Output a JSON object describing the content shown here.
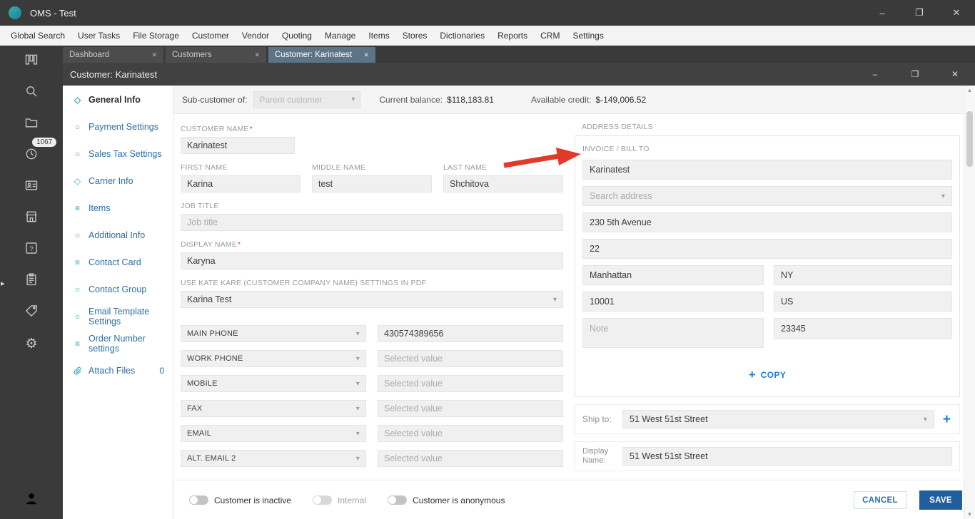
{
  "window": {
    "title": "OMS - Test"
  },
  "icons": {
    "chevron_down": "▾",
    "close": "✕",
    "minimize": "–",
    "restore": "❐",
    "plus": "+",
    "gear": "⚙",
    "question": "?",
    "diamond": "◇",
    "circle": "○",
    "lines": "≡",
    "arrow_up": "▲",
    "arrow_down": "▼",
    "expander": "▸"
  },
  "menu": {
    "items": [
      "Global Search",
      "User Tasks",
      "File Storage",
      "Customer",
      "Vendor",
      "Quoting",
      "Manage",
      "Items",
      "Stores",
      "Dictionaries",
      "Reports",
      "CRM",
      "Settings"
    ]
  },
  "tabs": [
    {
      "label": "Dashboard"
    },
    {
      "label": "Customers"
    },
    {
      "label": "Customer: Karinatest"
    }
  ],
  "sidebar": {
    "badge": "1067"
  },
  "inner_window": {
    "title": "Customer: Karinatest"
  },
  "subheader": {
    "sub_customer_label": "Sub-customer of:",
    "sub_customer_placeholder": "Parent customer",
    "current_balance_label": "Current balance:",
    "current_balance_value": "$118,183.81",
    "available_credit_label": "Available credit:",
    "available_credit_value": "$-149,006.52"
  },
  "nav": {
    "items": [
      {
        "label": "General Info",
        "icon": "diamond",
        "active": true
      },
      {
        "label": "Payment Settings",
        "icon": "circle"
      },
      {
        "label": "Sales Tax Settings",
        "icon": "circle"
      },
      {
        "label": "Carrier Info",
        "icon": "diamond"
      },
      {
        "label": "Items",
        "icon": "lines"
      },
      {
        "label": "Additional Info",
        "icon": "circle"
      },
      {
        "label": "Contact Card",
        "icon": "lines"
      },
      {
        "label": "Contact Group",
        "icon": "circle"
      },
      {
        "label": "Email Template Settings",
        "icon": "circle"
      },
      {
        "label": "Order Number settings",
        "icon": "lines"
      },
      {
        "label": "Attach Files",
        "icon": "paperclip",
        "badge": "0"
      }
    ]
  },
  "form": {
    "required_mark": "*",
    "customer_name": {
      "label": "CUSTOMER NAME",
      "value": "Karinatest"
    },
    "first_name": {
      "label": "FIRST NAME",
      "value": "Karina"
    },
    "middle_name": {
      "label": "MIDDLE NAME",
      "value": "test"
    },
    "last_name": {
      "label": "LAST NAME",
      "value": "Shchitova"
    },
    "job_title": {
      "label": "JOB TITLE",
      "placeholder": "Job title"
    },
    "display_name": {
      "label": "DISPLAY NAME",
      "value": "Karyna"
    },
    "pdf_settings": {
      "label": "USE KATE KARE (CUSTOMER COMPANY NAME) SETTINGS IN PDF",
      "value": "Karina Test"
    },
    "phones": [
      {
        "type": "MAIN PHONE",
        "value": "430574389656"
      },
      {
        "type": "WORK PHONE",
        "placeholder": "Selected value"
      },
      {
        "type": "MOBILE",
        "placeholder": "Selected value"
      },
      {
        "type": "FAX",
        "placeholder": "Selected value"
      },
      {
        "type": "EMAIL",
        "placeholder": "Selected value"
      },
      {
        "type": "ALT. EMAIL 2",
        "placeholder": "Selected value"
      }
    ],
    "toggles": [
      {
        "label": "Customer is inactive",
        "on": false
      },
      {
        "label": "Internal",
        "on": false,
        "muted": true
      },
      {
        "label": "Customer is anonymous",
        "on": false
      }
    ]
  },
  "address": {
    "title": "ADDRESS DETAILS",
    "section": "INVOICE / BILL TO",
    "name": "Karinatest",
    "search_placeholder": "Search address",
    "street": "230 5th Avenue",
    "apt": "22",
    "city": "Manhattan",
    "state": "NY",
    "zip": "10001",
    "country": "US",
    "note_placeholder": "Note",
    "extra": "23345",
    "copy_label": "COPY",
    "ship_to_label": "Ship to:",
    "ship_to_value": "51 West 51st Street",
    "display_name_label": "Display Name:",
    "display_name_value": "51 West 51st Street"
  },
  "footer": {
    "cancel_label": "CANCEL",
    "save_label": "SAVE"
  }
}
